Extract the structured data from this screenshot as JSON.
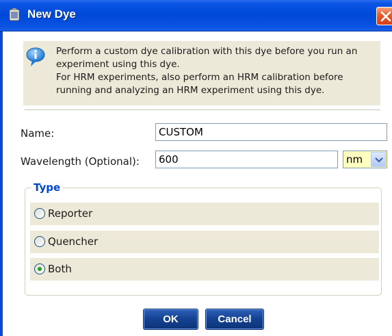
{
  "window": {
    "title": "New Dye"
  },
  "info": {
    "message": "Perform a custom dye calibration with this dye before you run an\nexperiment using this dye.\nFor HRM experiments, also perform an HRM calibration before\nrunning and analyzing an HRM experiment using this dye."
  },
  "form": {
    "name_label": "Name:",
    "name_value": "CUSTOM",
    "wavelength_label": "Wavelength (Optional):",
    "wavelength_value": "600",
    "unit_selected": "nm"
  },
  "type_group": {
    "legend": "Type",
    "options": [
      {
        "label": "Reporter",
        "selected": false
      },
      {
        "label": "Quencher",
        "selected": false
      },
      {
        "label": "Both",
        "selected": true
      }
    ]
  },
  "buttons": {
    "ok_label": "OK",
    "cancel_label": "Cancel"
  },
  "colors": {
    "titlebar": "#0048d8",
    "legend": "#0046d5",
    "unit_select_bg": "#ffffc0",
    "radio_selected": "#21a121"
  },
  "icons": {
    "title": "dye-bottle-icon",
    "info": "info-icon",
    "close": "close-icon",
    "dropdown": "chevron-down-icon"
  }
}
